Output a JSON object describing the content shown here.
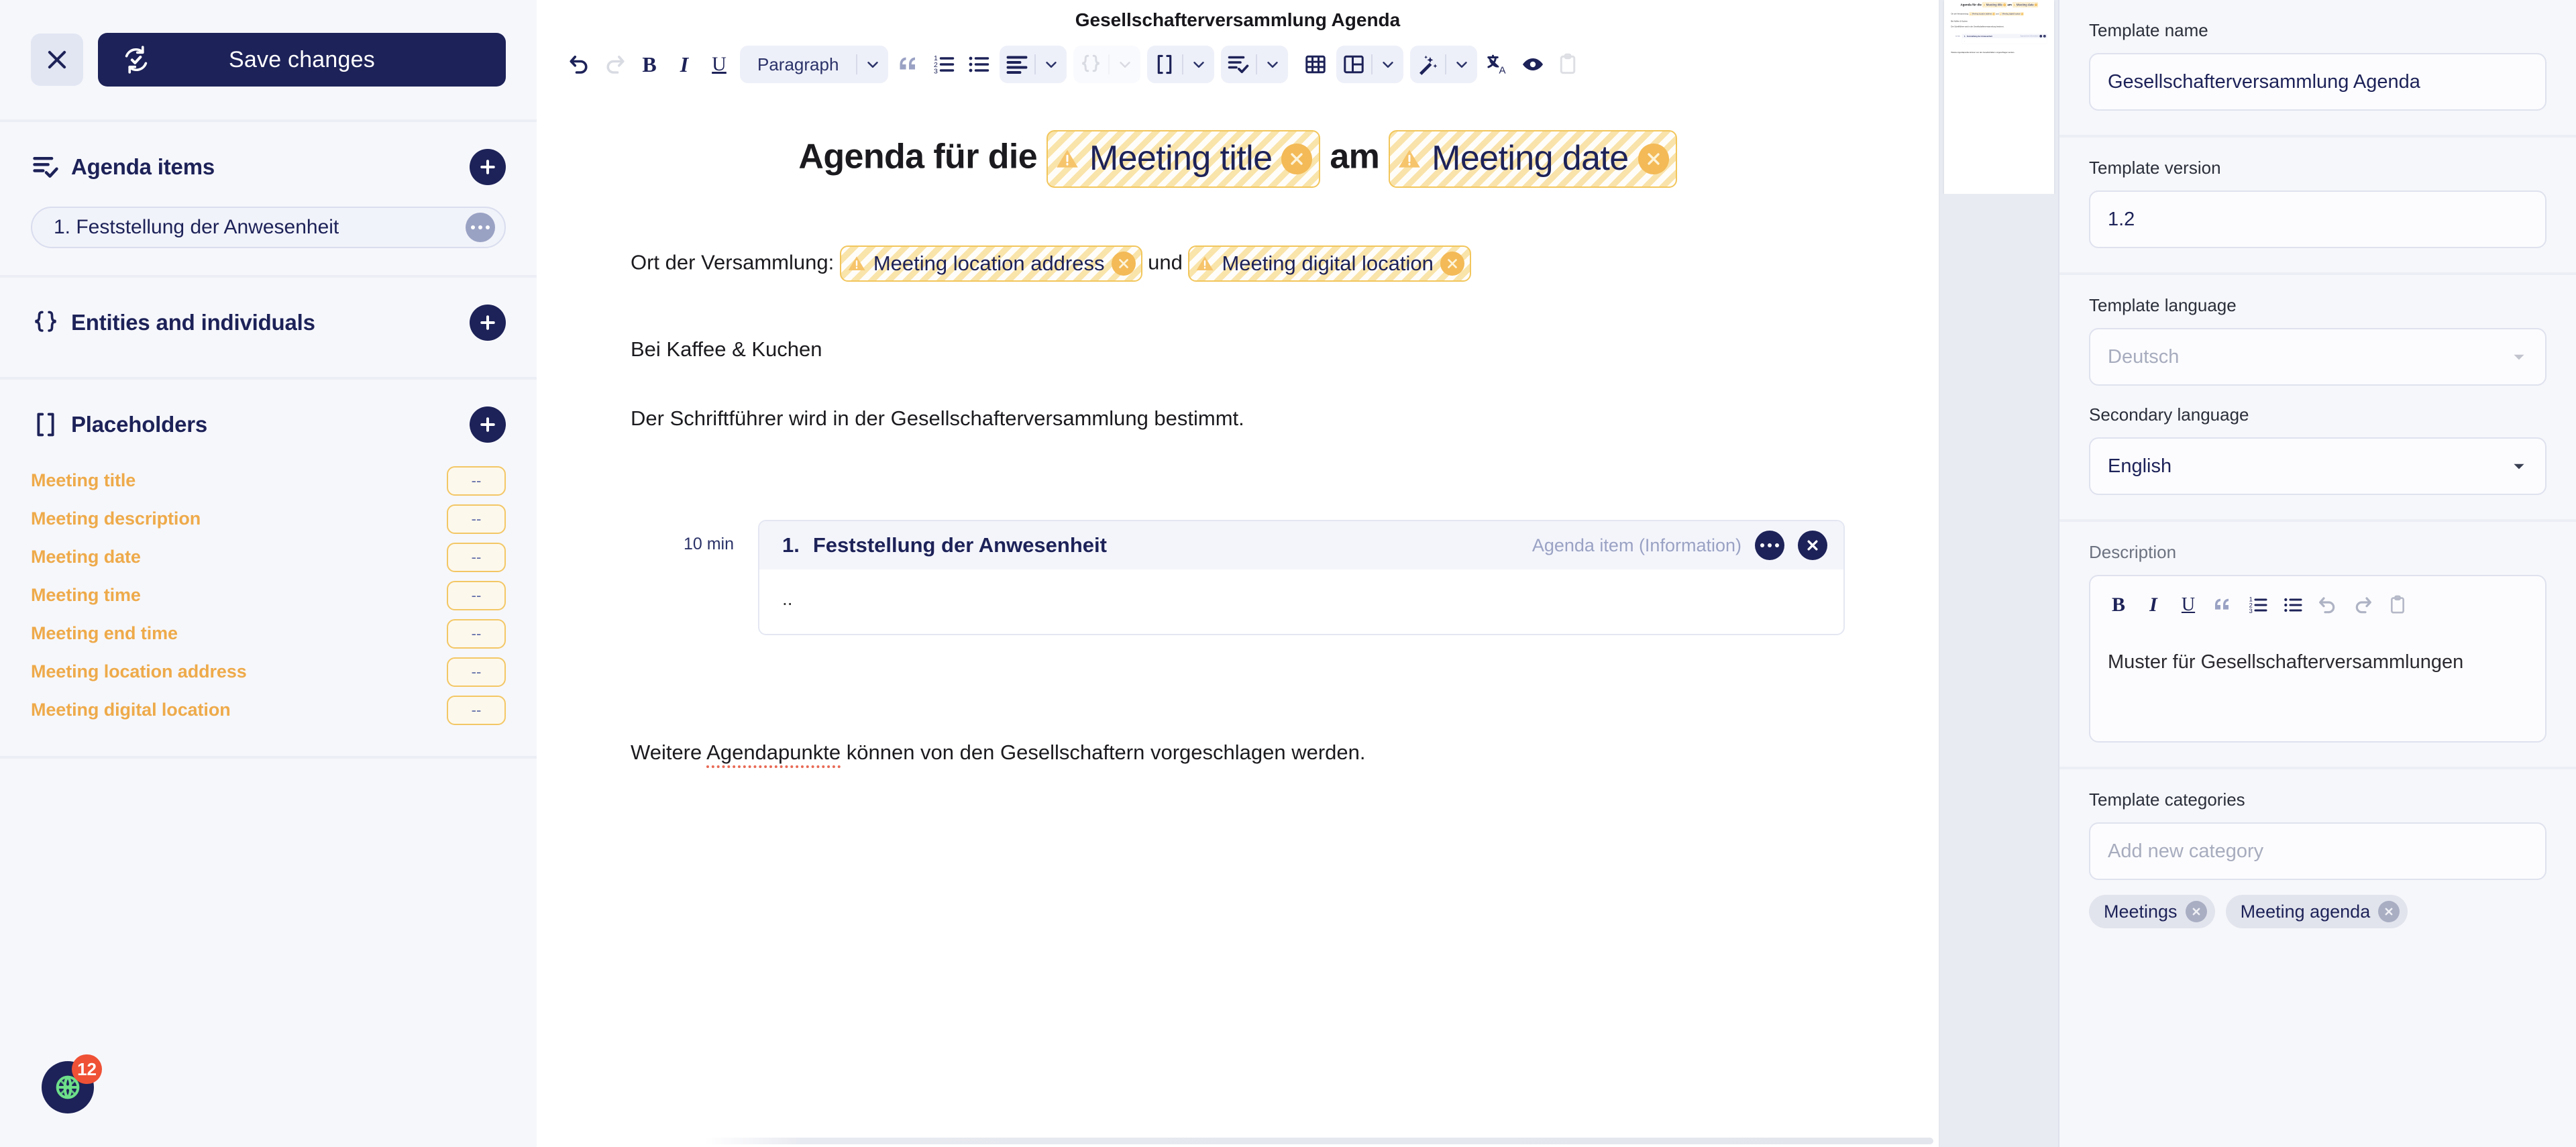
{
  "sidebar": {
    "close_icon": "close-icon",
    "save_label": "Save changes",
    "sync_icon": "sync-check-icon",
    "agenda_section": {
      "icon": "agenda-list-check-icon",
      "title": "Agenda items",
      "add_icon": "plus-icon",
      "items": [
        {
          "label": "1. Feststellung der Anwesenheit",
          "menu_icon": "ellipsis-icon"
        }
      ]
    },
    "entities_section": {
      "icon": "curly-braces-icon",
      "title": "Entities and individuals",
      "add_icon": "plus-icon",
      "items": []
    },
    "placeholders_section": {
      "icon": "square-brackets-icon",
      "title": "Placeholders",
      "add_icon": "plus-icon",
      "items": [
        {
          "name": "Meeting title",
          "value": "--"
        },
        {
          "name": "Meeting description",
          "value": "--"
        },
        {
          "name": "Meeting date",
          "value": "--"
        },
        {
          "name": "Meeting time",
          "value": "--"
        },
        {
          "name": "Meeting end time",
          "value": "--"
        },
        {
          "name": "Meeting location address",
          "value": "--"
        },
        {
          "name": "Meeting digital location",
          "value": "--"
        }
      ]
    },
    "fab": {
      "icon": "globe-network-icon",
      "badge": "12"
    }
  },
  "editor": {
    "doc_title": "Gesellschafterversammlung Agenda",
    "toolbar": {
      "undo": "undo-icon",
      "redo": "redo-icon",
      "bold": "B",
      "italic": "I",
      "underline": "U",
      "paragraph_label": "Paragraph",
      "quote": "blockquote-icon",
      "ordered_list": "ordered-list-icon",
      "bullet_list": "bullet-list-icon",
      "align": "align-left-icon",
      "entities": "curly-braces-icon",
      "placeholders": "square-brackets-icon",
      "agenda": "agenda-list-check-icon",
      "table": "table-icon",
      "layout": "layout-columns-icon",
      "magic": "magic-wand-icon",
      "translate": "translate-icon",
      "preview": "eye-icon",
      "clipboard": "clipboard-icon"
    },
    "document": {
      "heading": {
        "part1": "Agenda für die ",
        "ph1": "Meeting title",
        "part2": " am ",
        "ph2": "Meeting date"
      },
      "location_line": {
        "prefix": "Ort der Versammlung: ",
        "ph1": "Meeting location address",
        "middle": " und ",
        "ph2": "Meeting digital location"
      },
      "para_coffee": "Bei Kaffee & Kuchen",
      "para_secretary": "Der Schriftführer wird in der Gesellschafterversammlung bestimmt.",
      "agenda_item": {
        "duration": "10 min",
        "number": "1.",
        "title": "Feststellung der Anwesenheit",
        "type": "Agenda item (Information)",
        "menu_icon": "ellipsis-icon",
        "close_icon": "close-circle-icon",
        "body": ".."
      },
      "para_footer_a": "Weitere ",
      "para_footer_misspelled": "Agendapunkte",
      "para_footer_b": " können von den Gesellschaftern vorgeschlagen werden."
    }
  },
  "right_panel": {
    "template_name": {
      "label": "Template name",
      "value": "Gesellschafterversammlung Agenda"
    },
    "template_version": {
      "label": "Template version",
      "value": "1.2"
    },
    "template_language": {
      "label": "Template language",
      "value": "Deutsch",
      "disabled": true
    },
    "secondary_language": {
      "label": "Secondary language",
      "value": "English"
    },
    "description": {
      "label": "Description",
      "value": "Muster für Gesellschafterversammlungen",
      "toolbar": {
        "bold": "B",
        "italic": "I",
        "underline": "U",
        "quote": "blockquote-icon",
        "ordered_list": "ordered-list-icon",
        "bullet_list": "bullet-list-icon",
        "undo": "undo-icon",
        "redo": "redo-icon",
        "clipboard": "clipboard-icon"
      }
    },
    "categories": {
      "label": "Template categories",
      "placeholder": "Add new category",
      "chips": [
        "Meetings",
        "Meeting agenda"
      ]
    }
  },
  "colors": {
    "navy": "#1d2258",
    "panel_bg": "#f6f7fb",
    "placeholder_amber": "#eeaa4a",
    "badge_red": "#ef5136",
    "accent_green": "#6ee08a"
  }
}
